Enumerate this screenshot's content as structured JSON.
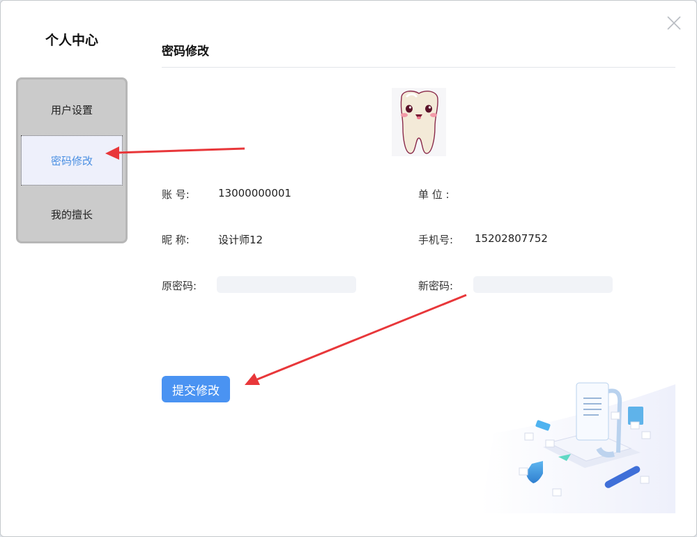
{
  "sidebar": {
    "title": "个人中心",
    "items": [
      {
        "label": "用户设置"
      },
      {
        "label": "密码修改"
      },
      {
        "label": "我的擅长"
      }
    ]
  },
  "main": {
    "title": "密码修改",
    "fields": {
      "account": {
        "label": "账  号:",
        "value": "13000000001"
      },
      "unit": {
        "label": "单  位 :",
        "value": ""
      },
      "nickname": {
        "label": "昵  称:",
        "value": "设计师12"
      },
      "phone": {
        "label": "手机号:",
        "value": "15202807752"
      },
      "old_password": {
        "label": "原密码:",
        "value": ""
      },
      "new_password": {
        "label": "新密码:",
        "value": ""
      }
    },
    "submit_label": "提交修改"
  },
  "colors": {
    "accent": "#4a93f2",
    "active_text": "#4a8fe2",
    "annotation_arrow": "#e8373a"
  },
  "icons": [
    "close-icon",
    "tooth-avatar",
    "document-illustration"
  ]
}
